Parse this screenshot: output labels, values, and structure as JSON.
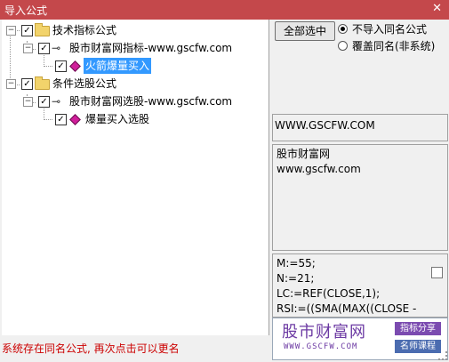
{
  "window": {
    "title": "导入公式",
    "close_glyph": "✕"
  },
  "tree": {
    "nodes": [
      {
        "label": "技术指标公式",
        "checked": true
      },
      {
        "label": "股市财富网指标-www.gscfw.com",
        "checked": true
      },
      {
        "label": "火箭爆量买入",
        "checked": true,
        "selected": true
      },
      {
        "label": "条件选股公式",
        "checked": true
      },
      {
        "label": "股市财富网选股-www.gscfw.com",
        "checked": true
      },
      {
        "label": "爆量买入选股",
        "checked": true
      }
    ]
  },
  "controls": {
    "select_all_label": "全部选中",
    "radio_skip_label": "不导入同名公式",
    "radio_overwrite_label": "覆盖同名(非系统)",
    "selected_option": "不导入同名公式"
  },
  "info": {
    "url_box": "WWW.GSCFW.COM",
    "description": "股市财富网\nwww.gscfw.com",
    "code": "M:=55;\nN:=21;\nLC:=REF(CLOSE,1);\nRSI:=((SMA(MAX((CLOSE -"
  },
  "status": {
    "message": "系统存在同名公式, 再次点击可以更名"
  },
  "watermark": {
    "name": "股市财富网",
    "url": "WWW.GSCFW.COM",
    "badge1": "指标分享",
    "badge2": "名师课程"
  },
  "colors": {
    "titlebar": "#c4484b",
    "selection": "#3399ff",
    "status_text": "#cc0000"
  }
}
